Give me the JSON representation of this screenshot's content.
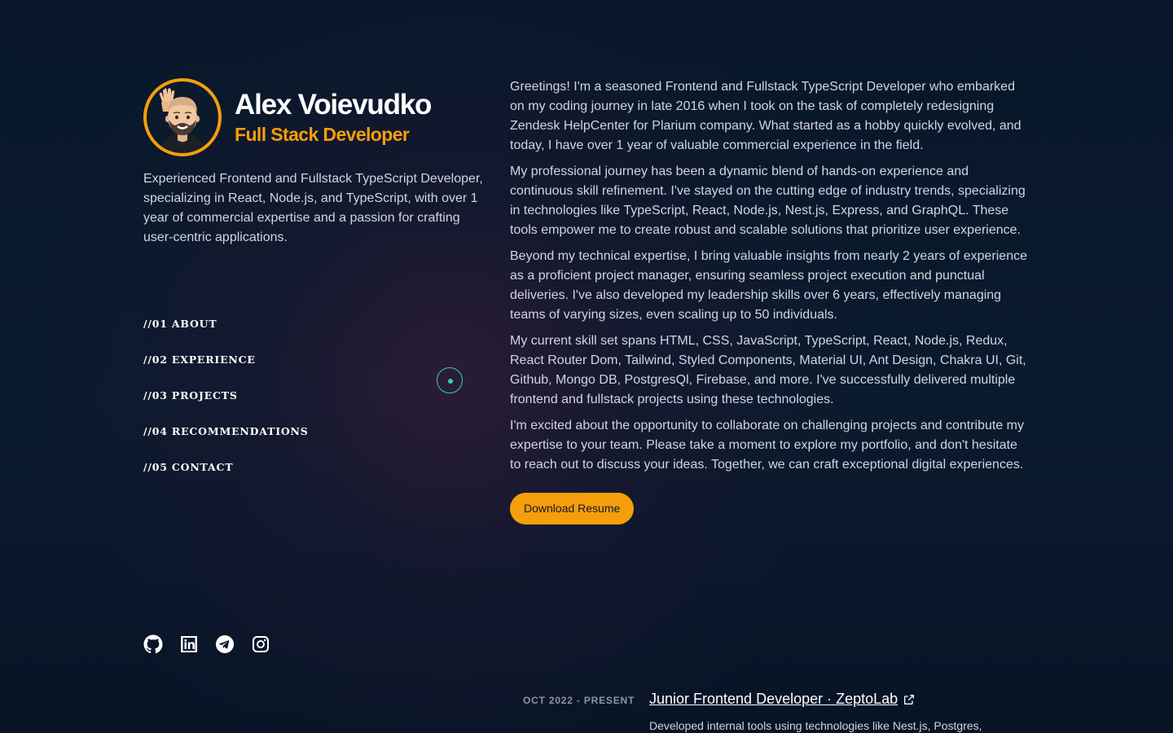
{
  "profile": {
    "name": "Alex Voievudko",
    "role": "Full Stack Developer",
    "summary": "Experienced Frontend and Fullstack TypeScript Developer, specializing in React, Node.js, and TypeScript, with over 1 year of commercial expertise and a passion for crafting user-centric applications."
  },
  "nav": {
    "items": [
      {
        "label": "//01 ABOUT"
      },
      {
        "label": "//02 EXPERIENCE"
      },
      {
        "label": "//03 PROJECTS"
      },
      {
        "label": "//04 RECOMMENDATIONS"
      },
      {
        "label": "//05 CONTACT"
      }
    ]
  },
  "socials": [
    "github-icon",
    "linkedin-icon",
    "telegram-icon",
    "instagram-icon"
  ],
  "about": {
    "paragraphs": [
      "Greetings! I'm a seasoned Frontend and Fullstack TypeScript Developer who embarked on my coding journey in late 2016 when I took on the task of completely redesigning Zendesk HelpCenter for Plarium company. What started as a hobby quickly evolved, and today, I have over 1 year of valuable commercial experience in the field.",
      "My professional journey has been a dynamic blend of hands-on experience and continuous skill refinement. I've stayed on the cutting edge of industry trends, specializing in technologies like TypeScript, React, Node.js, Nest.js, Express, and GraphQL. These tools empower me to create robust and scalable solutions that prioritize user experience.",
      "Beyond my technical expertise, I bring valuable insights from nearly 2 years of experience as a proficient project manager, ensuring seamless project execution and punctual deliveries. I've also developed my leadership skills over 6 years, effectively managing teams of varying sizes, even scaling up to 50 individuals.",
      "My current skill set spans HTML, CSS, JavaScript, TypeScript, React, Node.js, Redux, React Router Dom, Tailwind, Styled Components, Material UI, Ant Design, Chakra UI, Git, Github, Mongo DB, PostgresQl, Firebase, and more. I've successfully delivered multiple frontend and fullstack projects using these technologies.",
      "I'm excited about the opportunity to collaborate on challenging projects and contribute my expertise to your team. Please take a moment to explore my portfolio, and don't hesitate to reach out to discuss your ideas. Together, we can craft exceptional digital experiences."
    ],
    "resume_label": "Download Resume"
  },
  "experience": [
    {
      "date": "OCT 2022 - PRESENT",
      "title": "Junior Frontend Developer · ZeptoLab",
      "description": "Developed internal tools using technologies like Nest.js, Postgres,"
    }
  ],
  "colors": {
    "accent": "#f59e0b",
    "cursor": "#2dd4bf",
    "background": "#0a1628"
  }
}
